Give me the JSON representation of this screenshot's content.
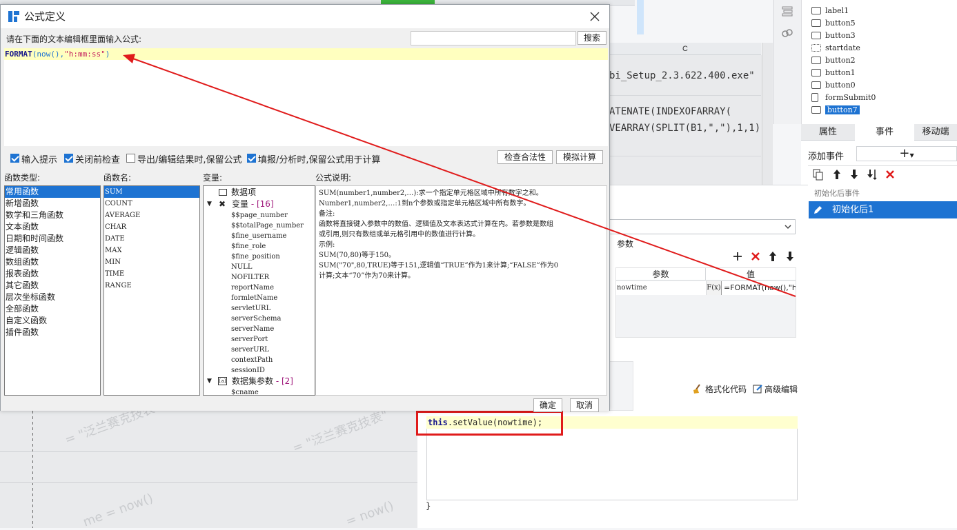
{
  "background": {
    "column_header": "C",
    "cells": [
      "bi_Setup_2.3.622.400.exe\"",
      "ATENATE(INDEXOFARRAY(",
      "VEARRAY(SPLIT(B1,\",\"),1,1),"
    ],
    "watermarks": [
      "= \"泛兰赛克技表\"",
      "= \"泛兰赛克技表\"",
      "me = now()",
      "= now()"
    ]
  },
  "widget_tree": {
    "items": [
      {
        "label": "label1",
        "icon": "label-icon"
      },
      {
        "label": "button5",
        "icon": "button-icon"
      },
      {
        "label": "button3",
        "icon": "button-icon"
      },
      {
        "label": "startdate",
        "icon": "calendar-icon"
      },
      {
        "label": "button2",
        "icon": "button-icon"
      },
      {
        "label": "button1",
        "icon": "button-icon"
      },
      {
        "label": "button0",
        "icon": "button-icon"
      },
      {
        "label": "formSubmit0",
        "icon": "form-submit-icon"
      },
      {
        "label": "button7",
        "icon": "button-icon",
        "selected": true
      }
    ]
  },
  "sidebar_tabs": [
    "属性",
    "事件",
    "移动端"
  ],
  "events": {
    "add_label": "添加事件",
    "add_symbol": "+",
    "group_label": "初始化后事件",
    "selected_item": "初始化后1"
  },
  "event_editor": {
    "params_label": "参数",
    "table_headers": [
      "参数",
      "值"
    ],
    "row": {
      "name": "nowtime",
      "fx": "F(x)",
      "value": "=FORMAT(now(),\"h"
    },
    "format_code": "格式化代码",
    "advanced_edit": "高级编辑",
    "code_this": "this",
    "code_rest": ".setValue(nowtime);",
    "closing_brace": "}"
  },
  "dialog": {
    "title": "公式定义",
    "prompt": "请在下面的文本编辑框里面输入公式:",
    "search_button": "搜索",
    "formula_fn": "FORMAT",
    "formula_mid": "(now(),",
    "formula_str": "\"h:mm:ss\"",
    "formula_end": ")",
    "checkboxes": [
      {
        "label": "输入提示",
        "checked": true
      },
      {
        "label": "关闭前检查",
        "checked": true
      },
      {
        "label": "导出/编辑结果时,保留公式",
        "checked": false
      },
      {
        "label": "填报/分析时,保留公式用于计算",
        "checked": true
      }
    ],
    "check_button": "检查合法性",
    "simulate_button": "模拟计算",
    "headers": {
      "types": "函数类型:",
      "names": "函数名:",
      "vars": "变量:",
      "desc": "公式说明:"
    },
    "types": [
      "常用函数",
      "新增函数",
      "数学和三角函数",
      "文本函数",
      "日期和时间函数",
      "逻辑函数",
      "数组函数",
      "报表函数",
      "其它函数",
      "层次坐标函数",
      "全部函数",
      "自定义函数",
      "插件函数"
    ],
    "names": [
      "SUM",
      "COUNT",
      "AVERAGE",
      "CHAR",
      "DATE",
      "MAX",
      "MIN",
      "TIME",
      "RANGE"
    ],
    "vars": {
      "data_item": "数据项",
      "var_group": "变量",
      "var_count": "- [16]",
      "var_items": [
        "$$page_number",
        "$$totalPage_number",
        "$fine_username",
        "$fine_role",
        "$fine_position",
        "NULL",
        "NOFILTER",
        "reportName",
        "formletName",
        "servletURL",
        "serverSchema",
        "serverName",
        "serverPort",
        "serverURL",
        "contextPath",
        "sessionID"
      ],
      "ds_group": "数据集参数",
      "ds_count": "- [2]",
      "ds_items": [
        "$cname"
      ]
    },
    "description": [
      "SUM(number1,number2,…):求一个指定单元格区域中所有数字之和。",
      "Number1,number2,…:1到n个参数或指定单元格区域中所有数字。",
      "备注:",
      "函数将直接键入参数中的数值、逻辑值及文本表达式计算在内。若参数是数组",
      "或引用,则只有数组或单元格引用中的数值进行计算。",
      "示例:",
      "SUM(70,80)等于150。",
      "SUM(\"70\",80,TRUE)等于151,逻辑值“TRUE”作为1来计算;“FALSE”作为0",
      "计算;文本“70”作为70来计算。"
    ],
    "ok_button": "确定",
    "cancel_button": "取消"
  },
  "colors": {
    "accent": "#1e73d2",
    "annotation": "#e01b1b",
    "formula_bg": "#ffffbf"
  }
}
